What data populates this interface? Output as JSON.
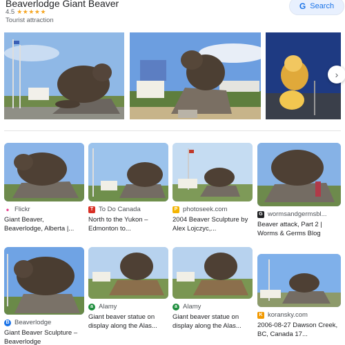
{
  "header": {
    "title": "Beaverlodge Giant Beaver",
    "rating_value": "4.5",
    "stars": "★★★★★",
    "subtitle": "Tourist attraction",
    "search_label": "Search",
    "search_logo": "G"
  },
  "carousel": {
    "next_icon": "chevron-right-icon",
    "next_glyph": "›"
  },
  "results": [
    {
      "source": "Flickr",
      "favicon": "•",
      "favicon_color": "#e8408f",
      "caption": "Giant Beaver, Beaverlodge, Alberta |..."
    },
    {
      "source": "To Do Canada",
      "favicon": "T",
      "favicon_color": "#d93025",
      "caption": "North to the Yukon – Edmonton to..."
    },
    {
      "source": "photoseek.com",
      "favicon": "P",
      "favicon_color": "#f4b400",
      "caption": "2004 Beaver Sculpture by Alex Lojczyc,..."
    },
    {
      "source": "wormsandgermsbl...",
      "favicon": "G",
      "favicon_color": "#202124",
      "caption": "Beaver attack, Part 2 | Worms & Germs Blog"
    },
    {
      "source": "Beaverlodge",
      "favicon": "B",
      "favicon_color": "#1a73e8",
      "caption": "Giant Beaver Sculpture – Beaverlodge"
    },
    {
      "source": "Alamy",
      "favicon": "a",
      "favicon_color": "#1e8e3e",
      "caption": "Giant beaver statue on display along the Alas..."
    },
    {
      "source": "Alamy",
      "favicon": "a",
      "favicon_color": "#1e8e3e",
      "caption": "Giant beaver statue on display along the Alas..."
    },
    {
      "source": "koransky.com",
      "favicon": "K",
      "favicon_color": "#f29900",
      "caption": "2006-08-27 Dawson Creek, BC, Canada 17..."
    }
  ],
  "colors": {
    "accent": "#1a73e8",
    "star": "#f5a623"
  }
}
